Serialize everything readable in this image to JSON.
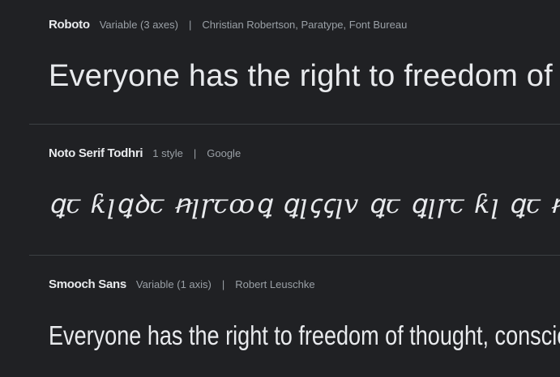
{
  "fonts": [
    {
      "family": "Roboto",
      "styles": "Variable (3 axes)",
      "separator": "|",
      "designers": "Christian Robertson, Paratype, Font Bureau",
      "sample": "Everyone has the right to freedom of thought, conscience and religion"
    },
    {
      "family": "Noto Serif Todhri",
      "styles": "1 style",
      "separator": "|",
      "designers": "Google",
      "sample": "ꝗꞇ ƙꞁꝗꝺꞇ ꞥꞁꞅꞇꝏꝗ ꝗꞁꞔꞔꞁv ꝗꞇ ꝗꞁꞅꞇ ƙꞁ ꝗꞇ ꞥꞁꞅ"
    },
    {
      "family": "Smooch Sans",
      "styles": "Variable (1 axis)",
      "separator": "|",
      "designers": "Robert Leuschke",
      "sample": "Everyone has the right to freedom of thought, conscience and religion"
    }
  ]
}
